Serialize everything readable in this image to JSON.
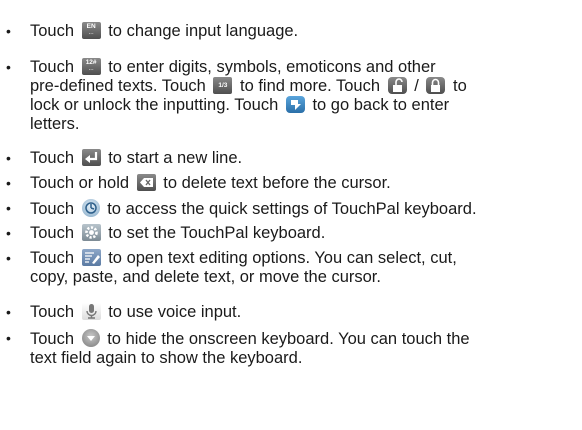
{
  "items": [
    {
      "t1": "Touch",
      "t2": "to change input language."
    },
    {
      "t1": "Touch",
      "t2": "to enter digits, symbols, emoticons and other",
      "t3": "pre-defined texts. Touch",
      "t4": "to find more. Touch",
      "t5": "/",
      "t6": "to",
      "t7": "lock or unlock the inputting. Touch",
      "t8": "to go back to enter",
      "t9": "letters."
    },
    {
      "t1": "Touch",
      "t2": "to start a new line."
    },
    {
      "t1": "Touch or hold",
      "t2": "to delete text before the cursor."
    },
    {
      "t1": "Touch",
      "t2": "to access the quick settings of TouchPal keyboard."
    },
    {
      "t1": "Touch",
      "t2": "to set the TouchPal keyboard."
    },
    {
      "t1": "Touch",
      "t2": "to open text editing options. You can select, cut,",
      "t3": "copy, paste, and delete text, or move the cursor."
    },
    {
      "t1": "Touch",
      "t2": "to use voice input."
    },
    {
      "t1": "Touch",
      "t2": "to hide the onscreen keyboard. You can touch the",
      "t3": "text field again to show the keyboard."
    }
  ],
  "icon_text": {
    "lang": "EN",
    "lang_dots": "...",
    "sym": "12#",
    "sym_dots": "...",
    "page": "1/3"
  },
  "icons": [
    "language-key-icon",
    "symbol-key-icon",
    "page-more-icon",
    "unlock-icon",
    "lock-icon",
    "back-icon",
    "enter-key-icon",
    "delete-key-icon",
    "quick-settings-icon",
    "settings-gear-icon",
    "text-edit-icon",
    "microphone-icon",
    "hide-keyboard-icon"
  ],
  "bullet": "•"
}
